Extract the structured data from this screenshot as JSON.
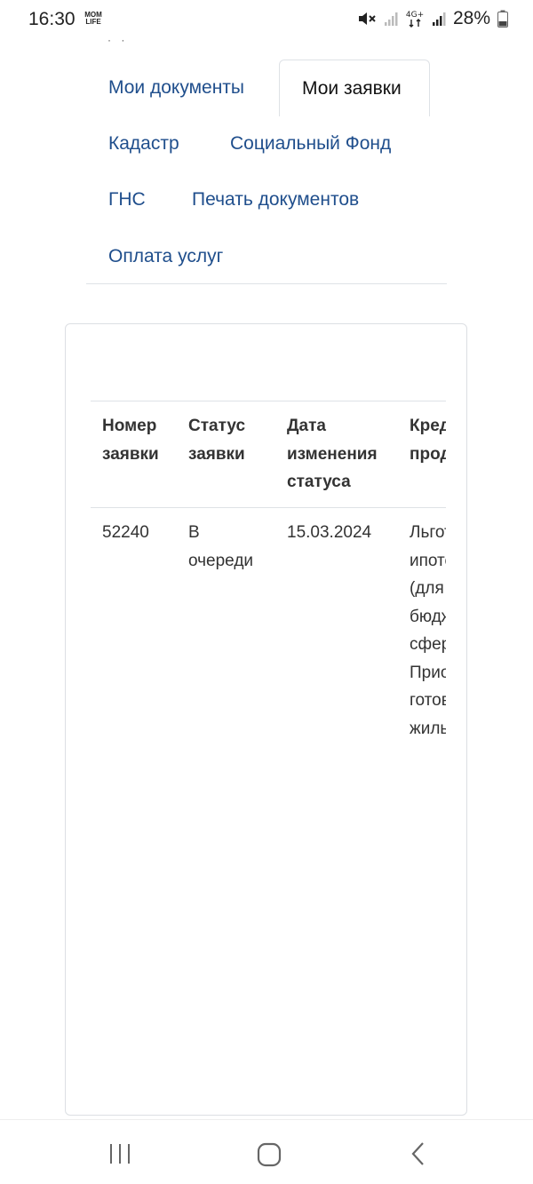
{
  "status_bar": {
    "time": "16:30",
    "app_badge_line1": "MOM",
    "app_badge_line2": "LIFE",
    "network": "4G+",
    "battery": "28%"
  },
  "tabs": {
    "items": [
      {
        "label": "Мои документы",
        "active": false
      },
      {
        "label": "Мои заявки",
        "active": true
      },
      {
        "label": "Кадастр",
        "active": false
      },
      {
        "label": "Социальный Фонд",
        "active": false
      },
      {
        "label": "ГНС",
        "active": false
      },
      {
        "label": "Печать документов",
        "active": false
      },
      {
        "label": "Оплата услуг",
        "active": false
      }
    ]
  },
  "table": {
    "headers": [
      {
        "line1": "Номер",
        "line2": "заявки"
      },
      {
        "line1": "Статус",
        "line2": "заявки"
      },
      {
        "line1": "Дата",
        "line2": "изменения",
        "line3": "статуса"
      },
      {
        "line1": "Кредитный",
        "line2": "продукт"
      }
    ],
    "rows": [
      {
        "number": "52240",
        "status_line1": "В",
        "status_line2": "очереди",
        "date": "15.03.2024",
        "product_lines": [
          "Льготная",
          "ипотека",
          "(для",
          "бюджетной",
          "сферы)",
          "Приобретение",
          "готового",
          "жилья"
        ]
      }
    ]
  },
  "nav_bar": {
    "recent": "recent-apps-icon",
    "home": "home-icon",
    "back": "back-icon"
  },
  "colors": {
    "link": "#1f4e8c",
    "border": "#dee2e6"
  }
}
